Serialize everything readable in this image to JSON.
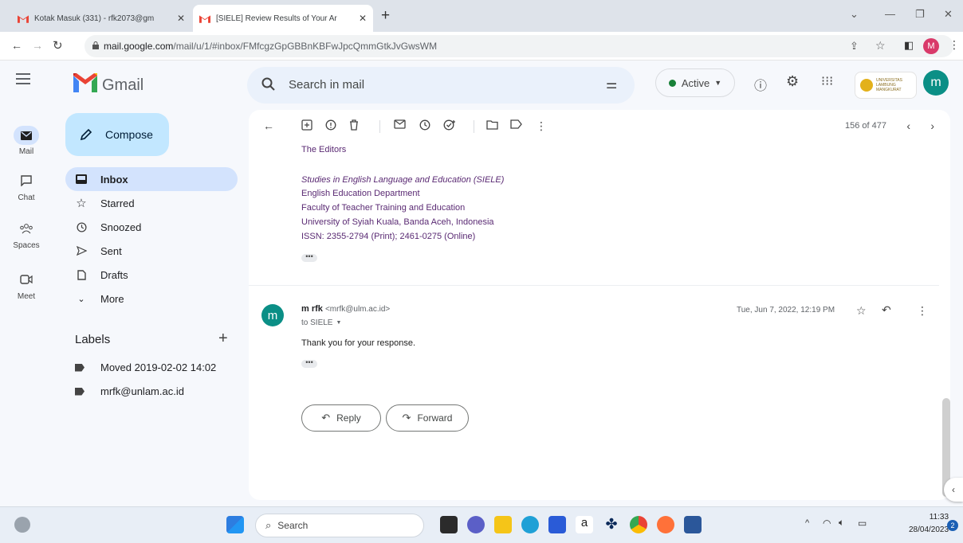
{
  "browser": {
    "tabs": [
      {
        "title": "Kotak Masuk (331) - rfk2073@gm",
        "active": false
      },
      {
        "title": "[SIELE] Review Results of Your Ar",
        "active": true
      }
    ],
    "new_tab": "+",
    "url_host": "mail.google.com",
    "url_path": "/mail/u/1/#inbox/FMfcgzGpGBBnKBFwJpcQmmGtkJvGwsWM",
    "profile_letter": "M"
  },
  "header": {
    "app_name": "Gmail",
    "search_placeholder": "Search in mail",
    "status": "Active",
    "org_logo_text": "UNIVERSITAS LAMBUNG MANGKURAT",
    "avatar_letter": "m"
  },
  "rail": {
    "items": [
      {
        "label": "Mail",
        "icon": "mail-icon",
        "selected": true
      },
      {
        "label": "Chat",
        "icon": "chat-icon",
        "selected": false
      },
      {
        "label": "Spaces",
        "icon": "spaces-icon",
        "selected": false
      },
      {
        "label": "Meet",
        "icon": "meet-icon",
        "selected": false
      }
    ]
  },
  "sidebar": {
    "compose_label": "Compose",
    "items": [
      {
        "label": "Inbox",
        "icon": "inbox-icon",
        "selected": true
      },
      {
        "label": "Starred",
        "icon": "star-icon",
        "selected": false
      },
      {
        "label": "Snoozed",
        "icon": "clock-icon",
        "selected": false
      },
      {
        "label": "Sent",
        "icon": "send-icon",
        "selected": false
      },
      {
        "label": "Drafts",
        "icon": "draft-icon",
        "selected": false
      },
      {
        "label": "More",
        "icon": "chevron-down-icon",
        "selected": false
      }
    ],
    "labels_heading": "Labels",
    "labels_add": "+",
    "labels": [
      {
        "label": "Moved 2019-02-02 14:02"
      },
      {
        "label": "mrfk@unlam.ac.id"
      }
    ]
  },
  "toolbar": {
    "pager": "156 of 477"
  },
  "thread": {
    "signature": {
      "closing": "The Editors",
      "journal": "Studies in English Language and Education (SIELE)",
      "dept": "English Education Department",
      "faculty": "Faculty of Teacher Training and Education",
      "university": "University of Syiah Kuala, Banda Aceh, Indonesia",
      "issn": "ISSN: 2355-2794 (Print); 2461-0275 (Online)"
    },
    "message": {
      "avatar_letter": "m",
      "sender_name": "m rfk",
      "sender_email": "<mrfk@ulm.ac.id>",
      "to": "to SIELE",
      "date": "Tue, Jun 7, 2022, 12:19 PM",
      "body": "Thank you for your response."
    },
    "ellipsis": "•••",
    "reply_label": "Reply",
    "forward_label": "Forward"
  },
  "taskbar": {
    "search_label": "Search",
    "time": "11:33",
    "date": "28/04/2023",
    "notification_count": "2"
  }
}
